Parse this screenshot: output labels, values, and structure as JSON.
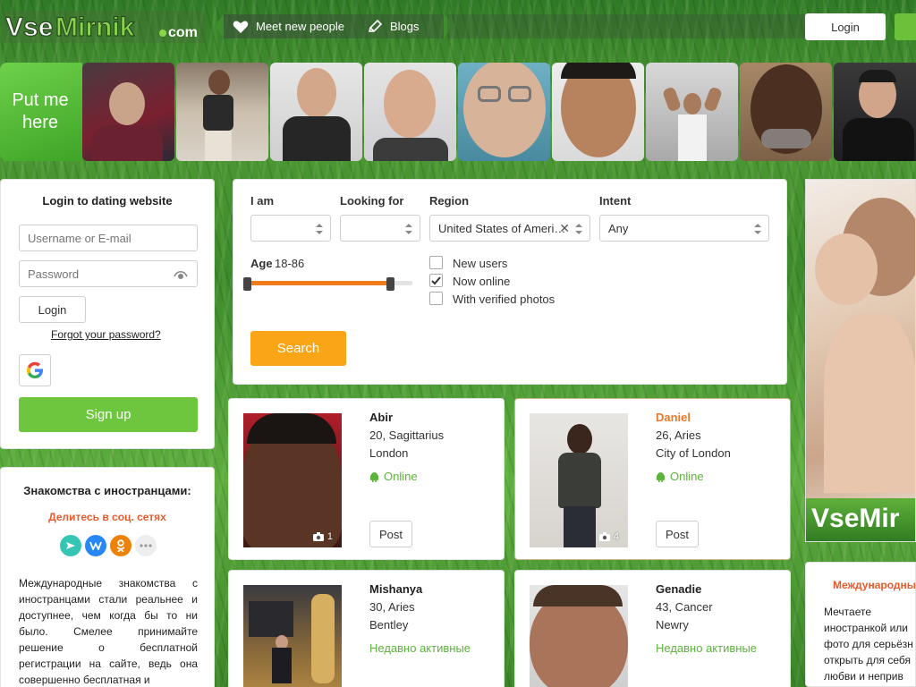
{
  "header": {
    "logo_text": "VseMirnik",
    "logo_domain": ".com",
    "nav": [
      {
        "label": "Meet new people",
        "icon": "heart-icon"
      },
      {
        "label": "Blogs",
        "icon": "pencil-icon"
      }
    ],
    "login_label": "Login"
  },
  "strip": {
    "promo_label": "Put me here",
    "photo_count": 9
  },
  "login_panel": {
    "title": "Login to dating website",
    "username_placeholder": "Username or E-mail",
    "password_placeholder": "Password",
    "login_button": "Login",
    "forgot_link": "Forgot your password?",
    "google_icon": "google-icon",
    "signup_button": "Sign up"
  },
  "info_panel": {
    "title": "Знакомства с иностранцами:",
    "share_title": "Делитесь в соц. сетях",
    "social": [
      {
        "icon": "send-icon",
        "color": "#35c5b5"
      },
      {
        "icon": "vk-icon",
        "color": "#2787f5"
      },
      {
        "icon": "ok-icon",
        "color": "#ee8208"
      },
      {
        "icon": "more-icon",
        "color": "#eeeeee"
      }
    ],
    "text": "Международные знакомства с иностранцами стали реальнее и доступнее, чем когда бы то ни было. Смелее принимайте решение о бесплатной регистрации на сайте, ведь она совершенно бесплатная и"
  },
  "search": {
    "i_am_label": "I am",
    "i_am_value": "",
    "looking_for_label": "Looking for",
    "looking_for_value": "",
    "region_label": "Region",
    "region_value": "United States of Ameri…",
    "intent_label": "Intent",
    "intent_value": "Any",
    "age_label": "Age",
    "age_value": "18-86",
    "age_min": 18,
    "age_max": 86,
    "checkboxes": [
      {
        "label": "New users",
        "checked": false
      },
      {
        "label": "Now online",
        "checked": true
      },
      {
        "label": "With verified photos",
        "checked": false
      }
    ],
    "search_button": "Search",
    "accent_color": "#f9a516",
    "slider_color": "#f07d1a"
  },
  "profiles": [
    {
      "name": "Abir",
      "age_sign": "20, Sagittarius",
      "city": "London",
      "status": "Online",
      "photos": "1",
      "post": "Post"
    },
    {
      "name": "Daniel",
      "age_sign": "26, Aries",
      "city": "City of London",
      "status": "Online",
      "photos": "4",
      "post": "Post"
    },
    {
      "name": "Mishanya",
      "age_sign": "30, Aries",
      "city": "Bentley",
      "status": "Недавно активные"
    },
    {
      "name": "Genadie",
      "age_sign": "43, Cancer",
      "city": "Newry",
      "status": "Недавно активные"
    }
  ],
  "ad": {
    "logo_text": "VseMir"
  },
  "right_panel": {
    "title": "Международны",
    "text": "Мечтаете иностранкой или фото для серьёзн открыть для себя любви и неприв"
  }
}
